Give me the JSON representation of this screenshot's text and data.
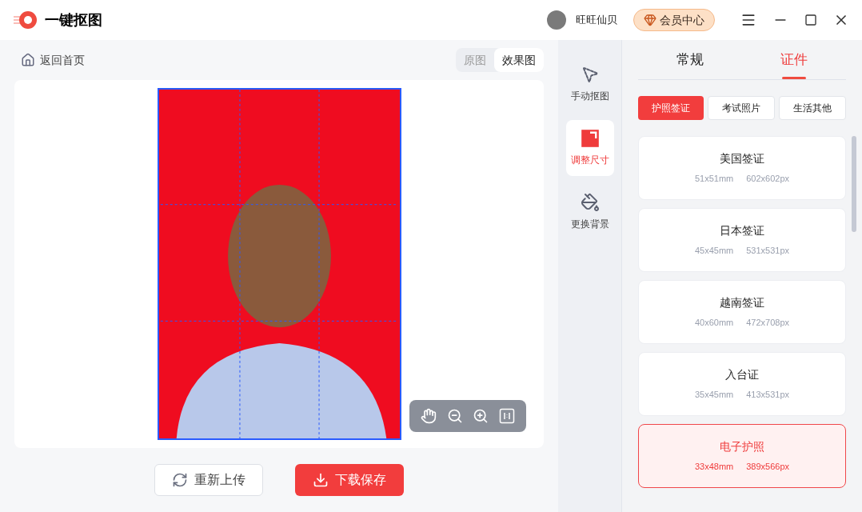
{
  "app": {
    "title": "一键抠图"
  },
  "user": {
    "name": "旺旺仙贝"
  },
  "vip_button": {
    "label": "会员中心"
  },
  "back_link": {
    "label": "返回首页"
  },
  "view_toggle": [
    {
      "label": "原图",
      "selected": false
    },
    {
      "label": "效果图",
      "selected": true
    }
  ],
  "tools": [
    {
      "kind": "cutout",
      "label": "手动抠图",
      "selected": false
    },
    {
      "kind": "resize",
      "label": "调整尺寸",
      "selected": true
    },
    {
      "kind": "background",
      "label": "更换背景",
      "selected": false
    }
  ],
  "actions": [
    {
      "kind": "reupload",
      "label": "重新上传"
    },
    {
      "kind": "download",
      "label": "下载保存"
    }
  ],
  "panel_tabs": [
    {
      "label": "常规",
      "selected": false
    },
    {
      "label": "证件",
      "selected": true
    }
  ],
  "categories": [
    {
      "label": "护照签证",
      "selected": true
    },
    {
      "label": "考试照片",
      "selected": false
    },
    {
      "label": "生活其他",
      "selected": false
    }
  ],
  "sizes": [
    {
      "name": "美国签证",
      "mm": "51x51mm",
      "px": "602x602px",
      "selected": false
    },
    {
      "name": "日本签证",
      "mm": "45x45mm",
      "px": "531x531px",
      "selected": false
    },
    {
      "name": "越南签证",
      "mm": "40x60mm",
      "px": "472x708px",
      "selected": false
    },
    {
      "name": "入台证",
      "mm": "35x45mm",
      "px": "413x531px",
      "selected": false
    },
    {
      "name": "电子护照",
      "mm": "33x48mm",
      "px": "389x566px",
      "selected": true
    }
  ]
}
